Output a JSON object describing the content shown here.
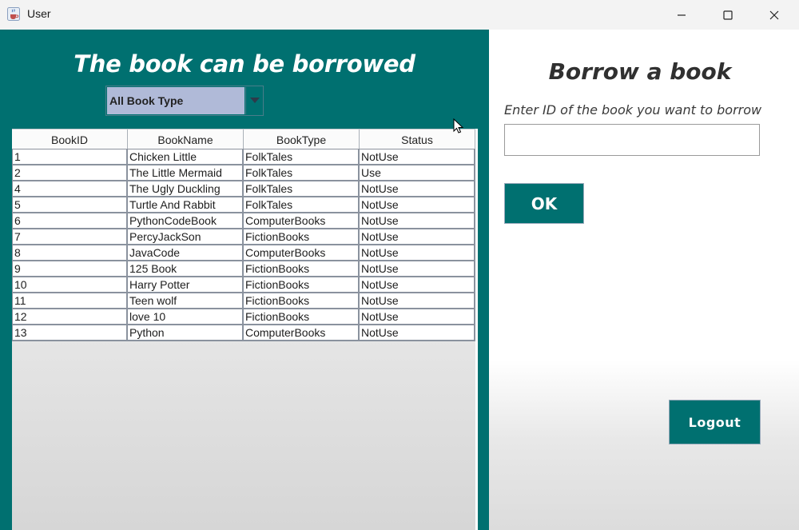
{
  "window": {
    "title": "User",
    "icon": "java-cup-icon"
  },
  "left": {
    "heading": "The book can be borrowed",
    "filter": {
      "selected": "All Book Type"
    },
    "table": {
      "columns": [
        "BookID",
        "BookName",
        "BookType",
        "Status"
      ],
      "rows": [
        [
          "1",
          "Chicken Little",
          "FolkTales",
          "NotUse"
        ],
        [
          "2",
          "The Little Mermaid",
          "FolkTales",
          "Use"
        ],
        [
          "4",
          "The Ugly Duckling",
          "FolkTales",
          "NotUse"
        ],
        [
          "5",
          "Turtle And Rabbit",
          "FolkTales",
          "NotUse"
        ],
        [
          "6",
          "PythonCodeBook",
          "ComputerBooks",
          "NotUse"
        ],
        [
          "7",
          "PercyJackSon",
          "FictionBooks",
          "NotUse"
        ],
        [
          "8",
          "JavaCode",
          "ComputerBooks",
          "NotUse"
        ],
        [
          "9",
          "125 Book",
          "FictionBooks",
          "NotUse"
        ],
        [
          "10",
          "Harry Potter",
          "FictionBooks",
          "NotUse"
        ],
        [
          "11",
          "Teen wolf",
          "FictionBooks",
          "NotUse"
        ],
        [
          "12",
          "love 10",
          "FictionBooks",
          "NotUse"
        ],
        [
          "13",
          "Python",
          "ComputerBooks",
          "NotUse"
        ]
      ]
    }
  },
  "right": {
    "heading": "Borrow a book",
    "prompt": "Enter ID of the book you want to borrow",
    "input_value": "",
    "ok_label": "OK",
    "logout_label": "Logout"
  },
  "colors": {
    "accent": "#007070",
    "combo_selected_bg": "#b0bad8"
  }
}
